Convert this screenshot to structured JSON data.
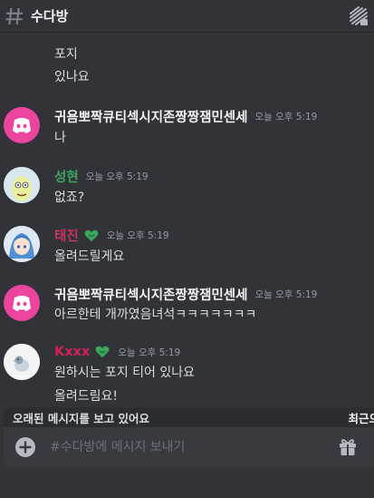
{
  "header": {
    "channel_name": "수다방"
  },
  "messages": [
    {
      "continuation": true,
      "lines": [
        "포지",
        "있나요"
      ]
    },
    {
      "username": "귀욤뽀짝큐티섹시지존짱짱잼민센세",
      "username_color": "#f2f3f5",
      "timestamp": "오늘 오후 5:19",
      "avatar": "discord-logo-avatar",
      "lines": [
        "나"
      ]
    },
    {
      "username": "성현",
      "username_color": "#3ba55d",
      "timestamp": "오늘 오후 5:19",
      "avatar": "cartoon-character-avatar",
      "lines": [
        "없죠?"
      ]
    },
    {
      "username": "태진",
      "username_color": "#c9335f",
      "timestamp": "오늘 오후 5:19",
      "avatar": "anime-character-avatar",
      "role_icon": "green-heart-role-icon",
      "lines": [
        "올려드릴게요"
      ]
    },
    {
      "username": "귀욤뽀짝큐티섹시지존짱짱잼민센세",
      "username_color": "#f2f3f5",
      "timestamp": "오늘 오후 5:19",
      "avatar": "discord-logo-avatar",
      "lines": [
        "아르한테 개까였음녀석ㅋㅋㅋㅋㅋㅋㅋ"
      ]
    },
    {
      "username": "Kxxx",
      "username_color": "#d32057",
      "timestamp": "오늘 오후 5:19",
      "avatar": "bird-avatar",
      "role_icon": "green-heart-role-icon",
      "lines": [
        "원하시는 포지 티어 있나요",
        "올려드림요!"
      ]
    }
  ],
  "history_bar": {
    "text": "오래된 메시지를 보고 있어요",
    "jump_label": "최근으"
  },
  "composer": {
    "placeholder": "#수다방에 메시지 보내기"
  },
  "colors": {
    "background": "#313338",
    "discord_avatar": "#eb459e",
    "role_green": "#3ba55d"
  }
}
